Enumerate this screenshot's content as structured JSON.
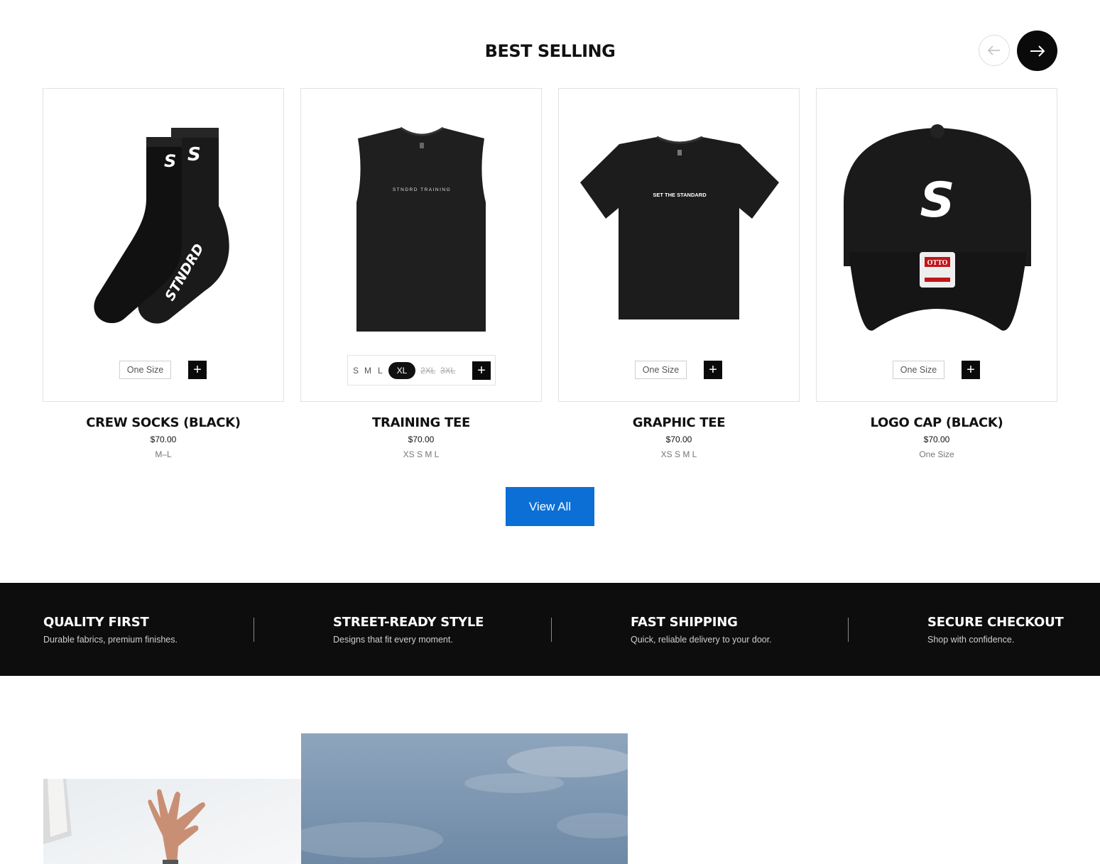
{
  "section": {
    "title": "BEST SELLING"
  },
  "nav": {
    "prev_icon": "arrow-left-icon",
    "next_icon": "arrow-right-icon"
  },
  "products": [
    {
      "name": "CREW SOCKS (BLACK)",
      "price": "$70.00",
      "sizes": "M–L",
      "size_option": "One Size",
      "add_label": "+",
      "graphic_text": "STNDRD",
      "logo_letter": "S"
    },
    {
      "name": "TRAINING TEE",
      "price": "$70.00",
      "sizes": "XS S M L",
      "size_options": [
        "S",
        "M",
        "L",
        "XL",
        "2XL",
        "3XL"
      ],
      "selected_size": "XL",
      "unavailable_sizes": [
        "2XL",
        "3XL"
      ],
      "add_label": "+",
      "graphic_text": "STNDRD TRAINING"
    },
    {
      "name": "GRAPHIC TEE",
      "price": "$70.00",
      "sizes": "XS S M L",
      "size_option": "One Size",
      "add_label": "+",
      "graphic_text": "SET THE STANDARD"
    },
    {
      "name": "LOGO CAP (BLACK)",
      "price": "$70.00",
      "sizes": "One Size",
      "size_option": "One Size",
      "add_label": "+",
      "logo_letter": "S",
      "tag_text": "OTTO"
    }
  ],
  "view_all": {
    "label": "View All"
  },
  "features": [
    {
      "title": "QUALITY FIRST",
      "description": "Durable fabrics, premium finishes."
    },
    {
      "title": "STREET-READY STYLE",
      "description": "Designs that fit every moment."
    },
    {
      "title": "FAST SHIPPING",
      "description": "Quick, reliable delivery to your door."
    },
    {
      "title": "SECURE CHECKOUT",
      "description": "Shop with confidence."
    }
  ],
  "colors": {
    "accent": "#0c6fd6",
    "dark": "#0d0d0d",
    "product": "#1c1c1c"
  }
}
